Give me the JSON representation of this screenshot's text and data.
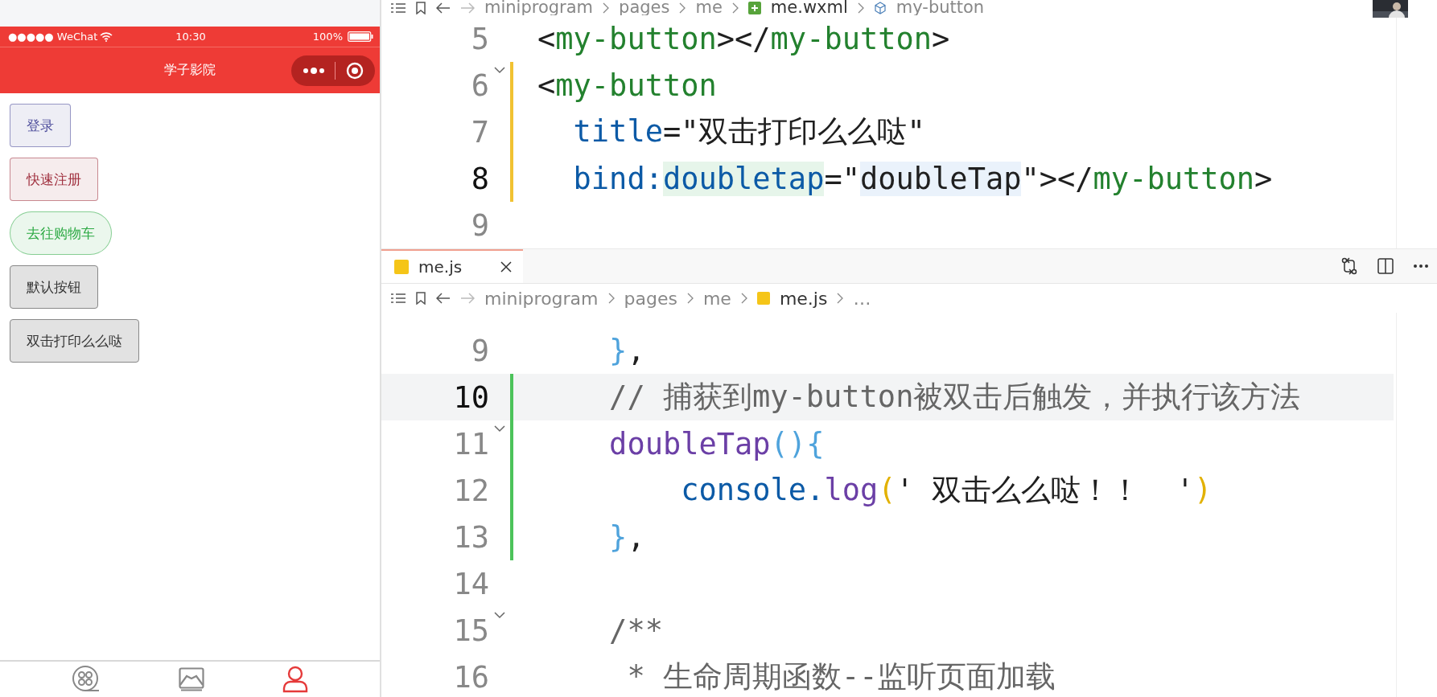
{
  "simulator": {
    "status_bar": {
      "carrier": "●●●●● WeChat",
      "time": "10:30",
      "battery": "100%"
    },
    "nav_bar": {
      "title": "学子影院"
    },
    "buttons": [
      {
        "label": "登录",
        "color": "#4a4a9a",
        "rounded": false
      },
      {
        "label": "快速注册",
        "color": "#a0303f",
        "rounded": false
      },
      {
        "label": "去往购物车",
        "color": "#2eaa45",
        "rounded": true
      },
      {
        "label": "默认按钮",
        "color": "#333333",
        "rounded": false
      },
      {
        "label": "双击打印么么哒",
        "color": "#333333",
        "rounded": false
      }
    ],
    "tab_bar": [
      {
        "kind": "film",
        "selected": false
      },
      {
        "kind": "picture",
        "selected": false
      },
      {
        "kind": "person",
        "selected": true
      }
    ]
  },
  "editor": {
    "top_breadcrumb": [
      "miniprogram",
      "pages",
      "me",
      "me.wxml",
      "my-button"
    ],
    "top_lines": [
      {
        "number": "5",
        "active": false,
        "modified": false,
        "added": false,
        "foldable": false,
        "tokens": [
          {
            "kind": "punct",
            "text": "<"
          },
          {
            "kind": "tag",
            "text": "my-button"
          },
          {
            "kind": "punct",
            "text": "></"
          },
          {
            "kind": "tag",
            "text": "my-button"
          },
          {
            "kind": "punct",
            "text": ">"
          }
        ]
      },
      {
        "number": "6",
        "active": false,
        "modified": true,
        "added": false,
        "foldable": true,
        "tokens": [
          {
            "kind": "punct",
            "text": "<"
          },
          {
            "kind": "tag",
            "text": "my-button"
          }
        ]
      },
      {
        "number": "7",
        "active": false,
        "modified": true,
        "added": false,
        "foldable": false,
        "tokens": [
          {
            "kind": "attr",
            "text": "  title"
          },
          {
            "kind": "punct",
            "text": "=\"双击打印么么哒\""
          }
        ]
      },
      {
        "number": "8",
        "active": true,
        "modified": true,
        "added": false,
        "foldable": false,
        "tokens": [
          {
            "kind": "attr",
            "text": "  bind:"
          },
          {
            "kind": "attr",
            "text": "doubletap",
            "matched": true
          },
          {
            "kind": "punct",
            "text": "=\""
          },
          {
            "kind": "punct",
            "text": "doubleTap",
            "occurrence": true
          },
          {
            "kind": "punct",
            "text": "\"></"
          },
          {
            "kind": "tag",
            "text": "my-button"
          },
          {
            "kind": "punct",
            "text": ">"
          }
        ]
      },
      {
        "number": "9",
        "active": false,
        "modified": false,
        "added": false,
        "foldable": false
      }
    ],
    "tab": {
      "label": "me.js",
      "selected": true
    },
    "bottom_breadcrumb": [
      "miniprogram",
      "pages",
      "me",
      "me.js",
      "…"
    ],
    "bottom_lines": [
      {
        "number": "9",
        "active": false,
        "modified": false,
        "added": false,
        "foldable": false,
        "tokens": [
          {
            "kind": "bracket",
            "text": "    }"
          },
          {
            "kind": "punct",
            "text": ","
          }
        ]
      },
      {
        "number": "10",
        "active": true,
        "modified": false,
        "added": true,
        "foldable": false,
        "tokens": [
          {
            "kind": "comment",
            "text": "    // 捕获到my-button被双击后触发，并执行该方法"
          }
        ]
      },
      {
        "number": "11",
        "active": false,
        "modified": false,
        "added": true,
        "foldable": true,
        "tokens": [
          {
            "kind": "func",
            "text": "    doubleTap"
          },
          {
            "kind": "bracket",
            "text": "(){"
          }
        ]
      },
      {
        "number": "12",
        "active": false,
        "modified": false,
        "added": true,
        "foldable": false,
        "tokens": [
          {
            "kind": "object",
            "text": "        console."
          },
          {
            "kind": "func",
            "text": "log"
          },
          {
            "kind": "paren",
            "text": "("
          },
          {
            "kind": "punct",
            "text": "' 双击么么哒！！  '"
          },
          {
            "kind": "paren",
            "text": ")"
          }
        ]
      },
      {
        "number": "13",
        "active": false,
        "modified": false,
        "added": true,
        "foldable": false,
        "tokens": [
          {
            "kind": "bracket",
            "text": "    }"
          },
          {
            "kind": "punct",
            "text": ","
          }
        ]
      },
      {
        "number": "14",
        "active": false,
        "modified": false,
        "added": false,
        "foldable": false
      },
      {
        "number": "15",
        "active": false,
        "modified": false,
        "added": false,
        "foldable": true,
        "tokens": [
          {
            "kind": "comment",
            "text": "    /**"
          }
        ]
      },
      {
        "number": "16",
        "active": false,
        "modified": false,
        "added": false,
        "foldable": false,
        "tokens": [
          {
            "kind": "comment",
            "text": "     * 生命周期函数--监听页面加载"
          }
        ]
      }
    ]
  }
}
